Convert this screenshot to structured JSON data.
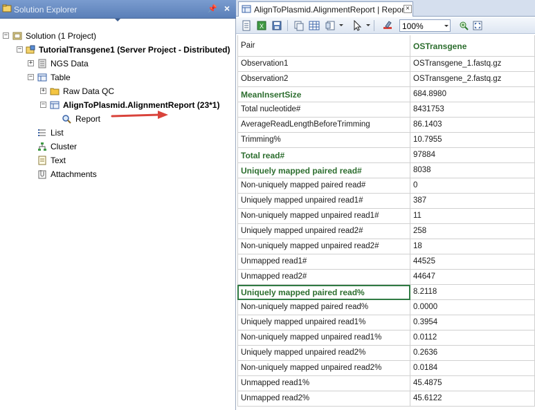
{
  "solution_explorer": {
    "title": "Solution Explorer",
    "tree": [
      {
        "label": "Solution (1 Project)",
        "expander": "−",
        "icon": "solution-icon",
        "bold": false
      },
      {
        "label": "TutorialTransgene1 (Server Project - Distributed)",
        "expander": "−",
        "icon": "project-icon",
        "bold": true
      },
      {
        "label": "NGS Data",
        "expander": "+",
        "icon": "ngs-data-icon",
        "bold": false
      },
      {
        "label": "Table",
        "expander": "−",
        "icon": "table-icon",
        "bold": false
      },
      {
        "label": "Raw Data QC",
        "expander": "+",
        "icon": "folder-icon",
        "bold": false
      },
      {
        "label": "AlignToPlasmid.AlignmentReport (23*1)",
        "expander": "−",
        "icon": "table-icon",
        "bold": true
      },
      {
        "label": "Report",
        "expander": "",
        "icon": "magnifier-icon",
        "bold": false
      },
      {
        "label": "List",
        "expander": "",
        "icon": "list-icon",
        "bold": false
      },
      {
        "label": "Cluster",
        "expander": "",
        "icon": "cluster-icon",
        "bold": false
      },
      {
        "label": "Text",
        "expander": "",
        "icon": "text-icon",
        "bold": false
      },
      {
        "label": "Attachments",
        "expander": "",
        "icon": "attachments-icon",
        "bold": false
      }
    ]
  },
  "document": {
    "tab_title": "AlignToPlasmid.AlignmentReport | Report",
    "zoom": "100%"
  },
  "grid": {
    "header": [
      "Pair",
      "OSTransgene"
    ],
    "rows": [
      {
        "label": "Observation1",
        "value": "OSTransgene_1.fastq.gz",
        "highlight": false
      },
      {
        "label": "Observation2",
        "value": "OSTransgene_2.fastq.gz",
        "highlight": false
      },
      {
        "label": "MeanInsertSize",
        "value": "684.8980",
        "highlight": true
      },
      {
        "label": "Total nucleotide#",
        "value": "8431753",
        "highlight": false
      },
      {
        "label": "AverageReadLengthBeforeTrimming",
        "value": "86.1403",
        "highlight": false
      },
      {
        "label": "Trimming%",
        "value": "10.7955",
        "highlight": false
      },
      {
        "label": "Total read#",
        "value": "97884",
        "highlight": true
      },
      {
        "label": "Uniquely mapped paired read#",
        "value": "8038",
        "highlight": true
      },
      {
        "label": "Non-uniquely mapped paired read#",
        "value": "0",
        "highlight": false
      },
      {
        "label": "Uniquely mapped unpaired read1#",
        "value": "387",
        "highlight": false
      },
      {
        "label": "Non-uniquely mapped unpaired read1#",
        "value": "11",
        "highlight": false
      },
      {
        "label": "Uniquely mapped unpaired read2#",
        "value": "258",
        "highlight": false
      },
      {
        "label": "Non-uniquely mapped unpaired read2#",
        "value": "18",
        "highlight": false
      },
      {
        "label": "Unmapped read1#",
        "value": "44525",
        "highlight": false
      },
      {
        "label": "Unmapped read2#",
        "value": "44647",
        "highlight": false
      },
      {
        "label": "Uniquely mapped paired read%",
        "value": "8.2118",
        "highlight": true,
        "selected": true
      },
      {
        "label": "Non-uniquely mapped paired read%",
        "value": "0.0000",
        "highlight": false
      },
      {
        "label": "Uniquely mapped unpaired read1%",
        "value": "0.3954",
        "highlight": false
      },
      {
        "label": "Non-uniquely mapped unpaired read1%",
        "value": "0.0112",
        "highlight": false
      },
      {
        "label": "Uniquely mapped unpaired read2%",
        "value": "0.2636",
        "highlight": false
      },
      {
        "label": "Non-uniquely mapped unpaired read2%",
        "value": "0.0184",
        "highlight": false
      },
      {
        "label": "Unmapped read1%",
        "value": "45.4875",
        "highlight": false
      },
      {
        "label": "Unmapped read2%",
        "value": "45.6122",
        "highlight": false
      }
    ]
  }
}
